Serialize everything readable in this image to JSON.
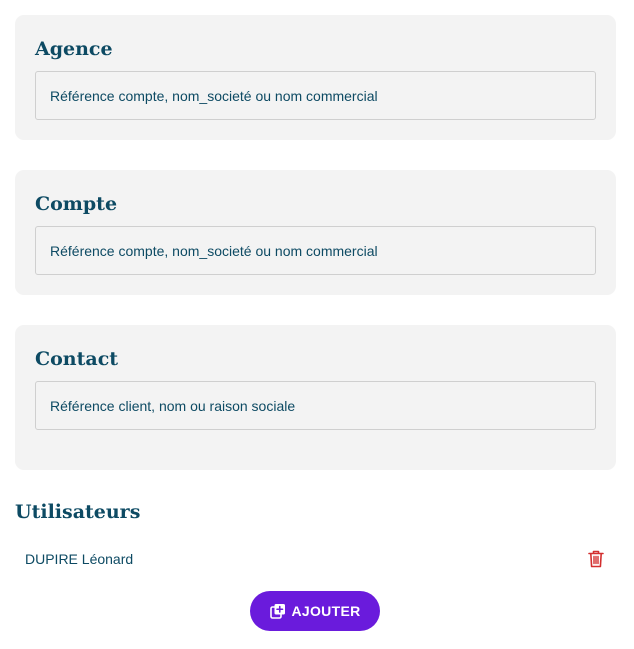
{
  "agence": {
    "title": "Agence",
    "placeholder": "Référence compte, nom_societé ou nom commercial"
  },
  "compte": {
    "title": "Compte",
    "placeholder": "Référence compte, nom_societé ou nom commercial"
  },
  "contact": {
    "title": "Contact",
    "placeholder": "Référence client, nom ou raison sociale"
  },
  "utilisateurs": {
    "title": "Utilisateurs",
    "users": [
      {
        "name": "DUPIRE Léonard"
      }
    ]
  },
  "actions": {
    "add_label": "AJOUTER"
  },
  "colors": {
    "primary_text": "#0d4a63",
    "card_background": "#f3f3f3",
    "button_background": "#6a1bdc",
    "delete_icon": "#d32f2f"
  },
  "icons": {
    "delete": "trash-icon",
    "add": "add-copy-icon"
  }
}
